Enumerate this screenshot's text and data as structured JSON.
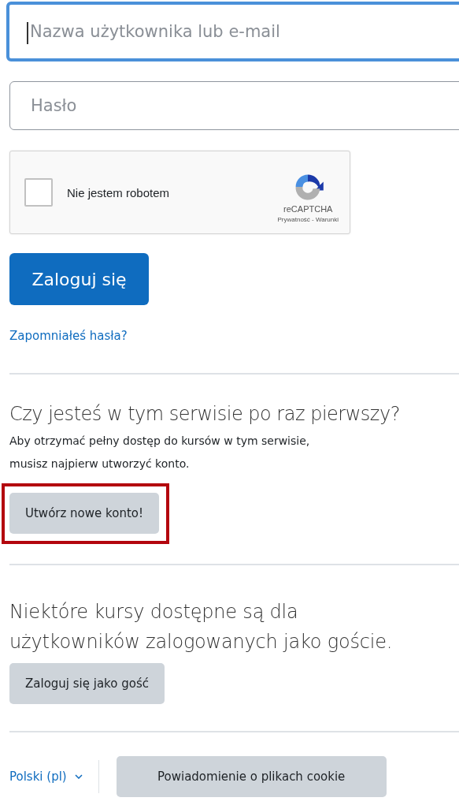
{
  "login_form": {
    "username": {
      "placeholder": "Nazwa użytkownika lub e-mail",
      "focused": true
    },
    "password": {
      "placeholder": "Hasło",
      "focused": false
    },
    "recaptcha": {
      "label": "Nie jestem robotem",
      "checked": false,
      "brand": "reCAPTCHA",
      "links": "Prywatność - Warunki"
    },
    "submit": "Zaloguj się",
    "forgot_link": "Zapomniałeś hasła?"
  },
  "signup": {
    "heading": "Czy jesteś w tym serwisie po raz pierwszy?",
    "text": "Aby otrzymać pełny dostęp do kursów w tym serwisie, musisz najpierw utworzyć konto.",
    "button": {
      "label": "Utwórz nowe konto!",
      "highlighted": true
    }
  },
  "guest": {
    "heading": "Niektóre kursy dostępne są dla użytkowników zalogowanych jako goście.",
    "button": {
      "label": "Zaloguj się jako gość"
    }
  },
  "footer": {
    "language": "Polski (pl)",
    "cookie_button": "Powiadomienie o plikach cookie"
  }
}
